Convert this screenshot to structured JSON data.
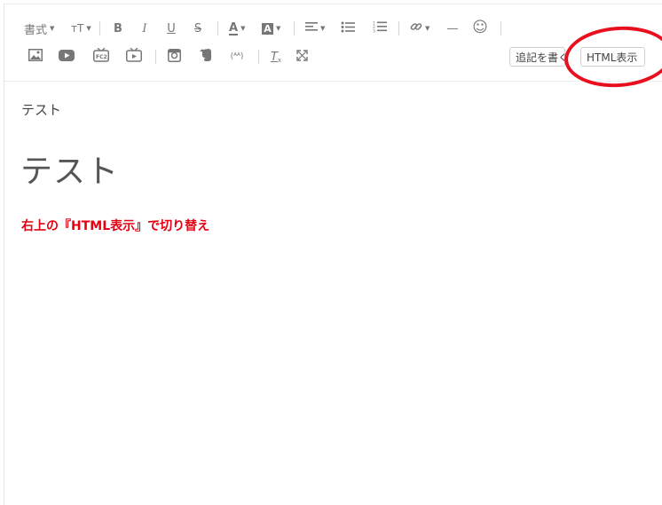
{
  "toolbar": {
    "format_label": "書式",
    "size_label": "тT",
    "bold_glyph": "B",
    "italic_glyph": "I",
    "underline_glyph": "U",
    "strike_glyph": "S",
    "font_color_glyph": "A",
    "bg_color_glyph": "A",
    "hr_glyph": "—",
    "emoji_glyph": "☺",
    "ruby_glyph": "(ᴬᴬ)",
    "clear_format_glyph": "T",
    "append_button_label": "追記を書く",
    "html_button_label": "HTML表示"
  },
  "content": {
    "paragraph_text": "テスト",
    "heading_text": "テスト",
    "note_text": "右上の『HTML表示』で切り替え"
  },
  "colors": {
    "annotation_ring": "#e8101f",
    "note_text": "#e60012"
  }
}
